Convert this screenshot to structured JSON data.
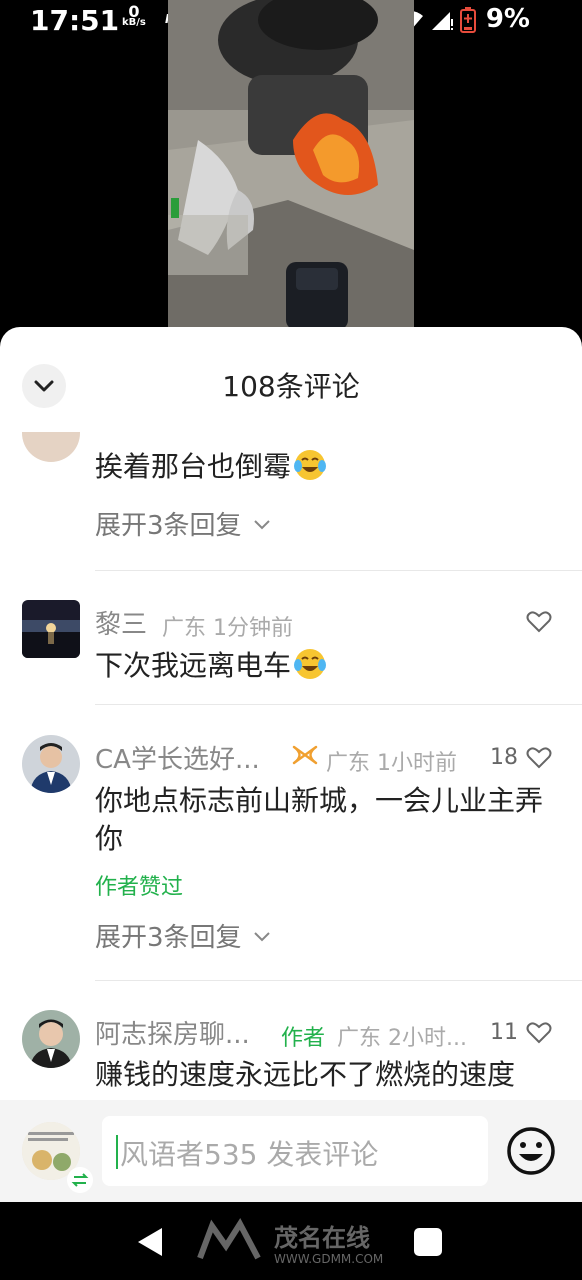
{
  "status_bar": {
    "time": "17:51",
    "net_speed_value": "0",
    "net_speed_unit": "kB/s",
    "hd_label": "HD",
    "battery_percent": "9%"
  },
  "sheet": {
    "title": "108条评论"
  },
  "comments": [
    {
      "text": "挨着那台也倒霉",
      "expand_label": "展开3条回复"
    },
    {
      "name": "黎三",
      "meta": "广东 1分钟前",
      "text": "下次我远离电车"
    },
    {
      "name": "CA学长选好...",
      "meta": "广东 1小时前",
      "likes": "18",
      "text": "你地点标志前山新城，一会儿业主弄你",
      "liked_by_author": "作者赞过",
      "expand_label": "展开3条回复"
    },
    {
      "name": "阿志探房聊...",
      "author_badge": "作者",
      "meta": "广东 2小时...",
      "likes": "11",
      "text": "赚钱的速度永远比不了燃烧的速度"
    }
  ],
  "input": {
    "placeholder": "风语者535 发表评论"
  },
  "watermark": {
    "brand": "茂名在线",
    "url": "WWW.GDMM.COM"
  },
  "colors": {
    "accent_green": "#22b14c",
    "sheet_bg": "#ffffff",
    "input_bar_bg": "#f4f4f4"
  }
}
